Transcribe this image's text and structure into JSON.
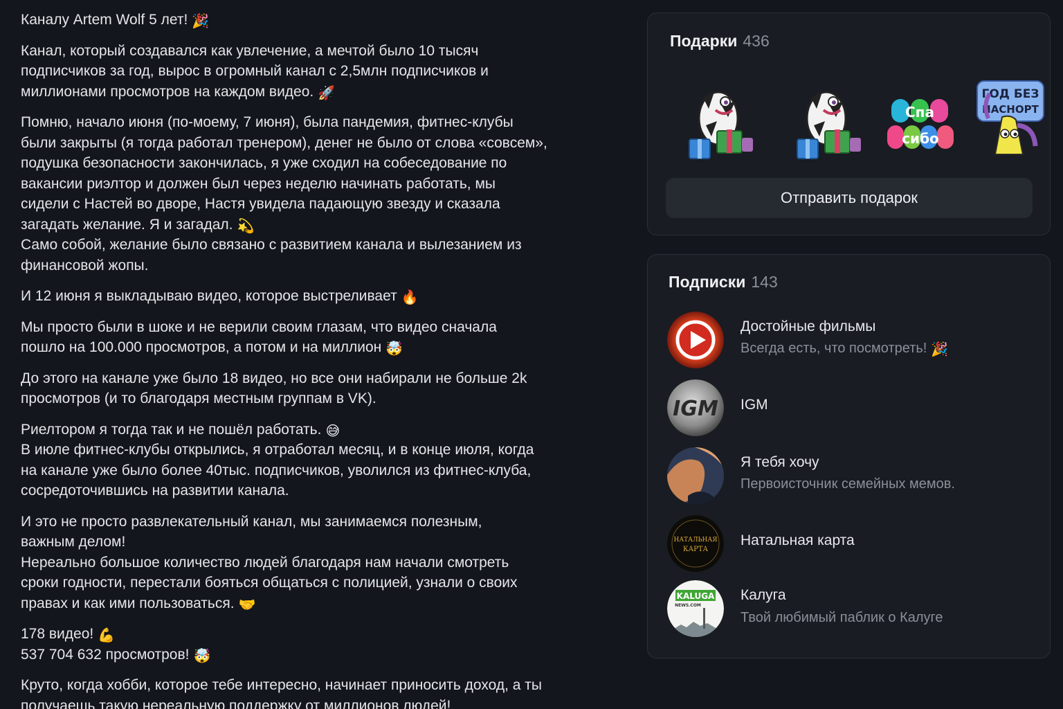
{
  "post": {
    "title": "Каналу Artem Wolf 5 лет!",
    "title_emoji": "🎉",
    "p1": [
      "Канал, который создавался как увлечение, а мечтой было 10 тысяч",
      "подписчиков за год, вырос в огромный канал с 2,5млн подписчиков и",
      "миллионами просмотров на каждом видео."
    ],
    "p1_emoji": "🚀",
    "p2": [
      "Помню, начало июня (по-моему, 7 июня), была пандемия, фитнес-клубы",
      "были закрыты (я тогда работал тренером), денег не было от слова «совсем»,",
      "подушка безопасности закончилась, я уже сходил на собеседование по",
      "вакансии риэлтор и должен был через неделю начинать работать, мы",
      "сидели с Настей во дворе, Настя увидела падающую звезду и сказала",
      "загадать желание. Я и загадал."
    ],
    "p2_emoji": "💫",
    "p2b": [
      "Само собой, желание было связано с развитием канала и вылезанием из",
      "финансовой жопы."
    ],
    "p3": "И 12 июня я выкладываю видео, которое выстреливает",
    "p3_emoji": "🔥",
    "p4": [
      "Мы просто были в шоке и не верили своим глазам, что видео сначала",
      "пошло на 100.000 просмотров, а потом и на миллион"
    ],
    "p4_emoji": "🤯",
    "p5": [
      "До этого на канале уже было 18 видео, но все они набирали не больше 2k",
      "просмотров (и то благодаря местным группам в VK)."
    ],
    "p6a": "Риелтором я тогда так и не пошёл работать.",
    "p6a_emoji": "😅",
    "p6": [
      "В июле фитнес-клубы открылись, я отработал месяц, и в конце июля, когда",
      "на канале уже было более 40тыс. подписчиков, уволился из фитнес-клуба,",
      "сосредоточившись на развитии канала."
    ],
    "p7": [
      "И это не просто развлекательный канал, мы занимаемся полезным,",
      "важным делом!",
      "Нереально большое количество людей благодаря нам начали смотреть",
      "сроки годности, перестали бояться общаться с полицией, узнали о своих",
      "правах и как ими пользоваться."
    ],
    "p7_emoji": "🤝",
    "stat_videos": "178 видео!",
    "stat_videos_emoji": "💪",
    "stat_views": "537 704 632 просмотров!",
    "stat_views_emoji": "🤯",
    "p9": [
      "Круто, когда хобби, которое тебе интересно, начинает приносить доход, а ты",
      "получаешь такую нереальную поддержку от миллионов людей!"
    ]
  },
  "gifts": {
    "title": "Подарки",
    "count": "436",
    "items": [
      {
        "icon": "zebra-gift-sticker"
      },
      {
        "icon": "zebra-gift-sticker"
      },
      {
        "icon": "spa-sibo-sticker",
        "text": [
          "Спа",
          "сибо"
        ]
      },
      {
        "icon": "god-bez-nasmorka-sticker",
        "text": [
          "ГОД БЕЗ",
          "НАСНОРТ"
        ]
      }
    ],
    "send_label": "Отправить подарок"
  },
  "subscriptions": {
    "title": "Подписки",
    "count": "143",
    "items": [
      {
        "name": "Достойные фильмы",
        "desc": "Всегда есть, что посмотреть!",
        "desc_emoji": "🎉",
        "icon": "play-avatar"
      },
      {
        "name": "IGM",
        "desc": "",
        "icon": "igm-avatar",
        "logo": "IGM"
      },
      {
        "name": "Я тебя хочу",
        "desc": "Первоисточник семейных мемов.",
        "icon": "abstract-avatar"
      },
      {
        "name": "Натальная карта",
        "desc": "",
        "icon": "natal-avatar",
        "logo": [
          "НАТАЛЬНАЯ",
          "КАРТА"
        ]
      },
      {
        "name": "Калуга",
        "desc": "Твой любимый паблик о Калуге",
        "icon": "kaluga-avatar",
        "logo": [
          "KALUGA",
          "NEWS.COM"
        ]
      }
    ]
  },
  "colors": {
    "background": "#13161c",
    "card": "#191c22",
    "button": "#262a31",
    "muted_text": "#8b8f98"
  }
}
